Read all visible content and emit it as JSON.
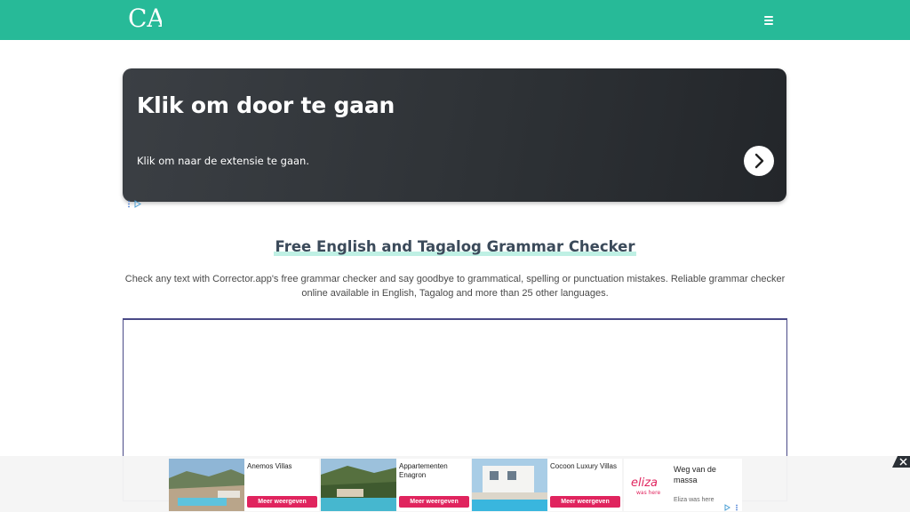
{
  "header": {
    "logo_text": "CA",
    "menu_icon": "hamburger-menu-icon",
    "colors": {
      "bar": "#27ba98"
    }
  },
  "ad_banner": {
    "headline": "Klik om door te gaan",
    "subtext": "Klik om naar de extensie te gaan.",
    "arrow_icon": "chevron-right-icon",
    "adchoices_icon": "adchoices-icon"
  },
  "main": {
    "title": "Free English and Tagalog Grammar Checker",
    "intro": "Check any text with Corrector.app's free grammar checker and say goodbye to grammatical, spelling or punctuation mistakes. Reliable grammar checker online available in English, Tagalog and more than 25 other languages.",
    "editor_value": ""
  },
  "bottom_ad": {
    "close_icon": "close-icon",
    "cards": [
      {
        "title": "Anemos Villas",
        "button": "Meer weergeven"
      },
      {
        "title": "Appartementen Enagron",
        "button": "Meer weergeven"
      },
      {
        "title": "Cocoon Luxury Villas",
        "button": "Meer weergeven"
      }
    ],
    "sponsor": {
      "logo_text": "eliza",
      "logo_sub": "was here",
      "title": "Weg van de massa",
      "source": "Eliza was here"
    }
  }
}
